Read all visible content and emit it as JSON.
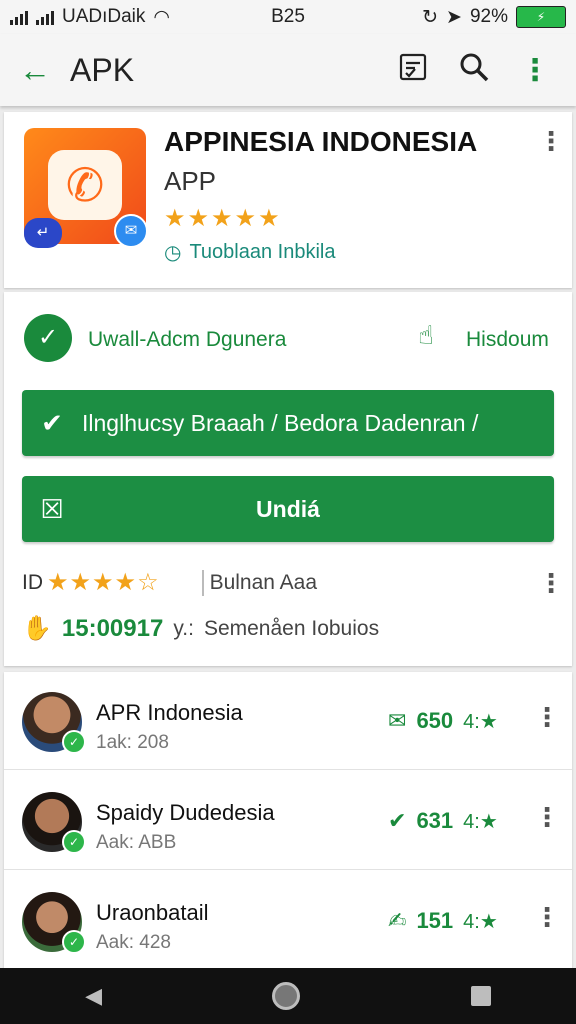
{
  "status_bar": {
    "carrier": "UADıDaik",
    "time": "B25",
    "battery_percent": "92%"
  },
  "toolbar": {
    "title": "APK"
  },
  "app": {
    "name": "APPINESIA INDONESIA",
    "subtitle": "APP",
    "stars": "★★★★★",
    "developer": "Tuoblaan Inbkila"
  },
  "install": {
    "status": "Uwall-Adcm Dgunera",
    "download_label": "Hisdoum",
    "primary_button": "Ilnglhucsy Braaah / Bedora Dadenran /",
    "secondary_button": "Undiá",
    "rating_prefix": "ID",
    "rating_stars": "★★★★☆",
    "rating_aux": "Bulnan Aaa",
    "downloads": "15:00917",
    "downloads_suffix": "y.:",
    "downloads_note": "Semenåen Iobuios"
  },
  "reviews": [
    {
      "name": "APR Indonesia",
      "meta": "1ak: 208",
      "score": "650",
      "score_suffix": "4:★"
    },
    {
      "name": "Spaidy Dudedesia",
      "meta": "Aak: ABB",
      "score": "631",
      "score_suffix": "4:★"
    },
    {
      "name": "Uraonbatail",
      "meta": "Aak: 428",
      "score": "151",
      "score_suffix": "4:★"
    }
  ],
  "colors": {
    "accent_green": "#1c8e43",
    "star": "#f2a21a"
  }
}
